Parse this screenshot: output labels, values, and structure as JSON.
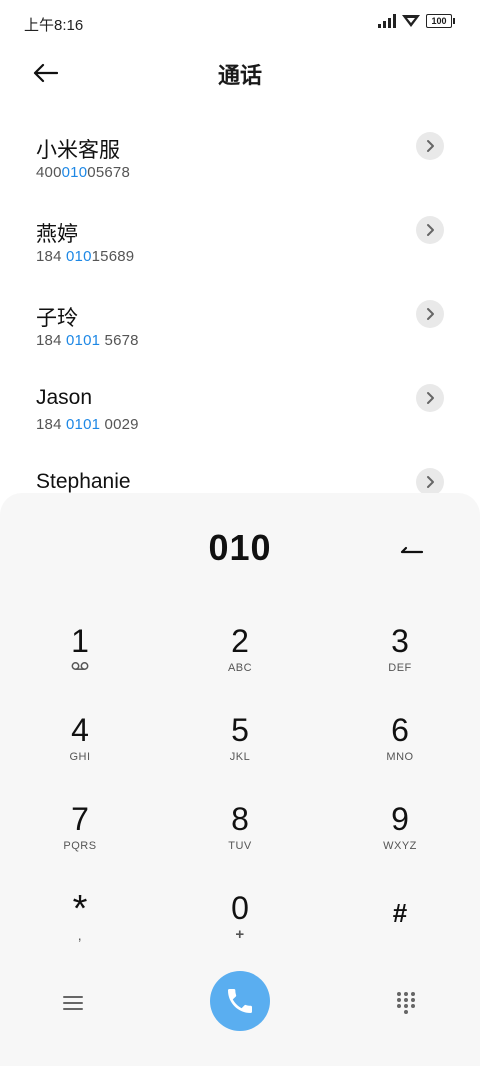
{
  "status_bar": {
    "time": "上午8:16",
    "battery": "100"
  },
  "header": {
    "title": "通话"
  },
  "contacts": [
    {
      "name": "小米客服",
      "number_parts": [
        "400",
        "010",
        "05678"
      ]
    },
    {
      "name": "燕婷",
      "number_parts": [
        "184 ",
        "010",
        "15689"
      ]
    },
    {
      "name": "子玲",
      "number_parts": [
        "184 ",
        "0101",
        " 5678"
      ]
    },
    {
      "name": "Jason",
      "number_parts": [
        "184 ",
        "0101",
        " 0029"
      ]
    },
    {
      "name": "Stephanie",
      "number_parts": [
        "",
        "",
        ""
      ]
    }
  ],
  "dialpad": {
    "dialed_number": "010",
    "keys": [
      {
        "digit": "1",
        "sub": ""
      },
      {
        "digit": "2",
        "sub": "ABC"
      },
      {
        "digit": "3",
        "sub": "DEF"
      },
      {
        "digit": "4",
        "sub": "GHI"
      },
      {
        "digit": "5",
        "sub": "JKL"
      },
      {
        "digit": "6",
        "sub": "MNO"
      },
      {
        "digit": "7",
        "sub": "PQRS"
      },
      {
        "digit": "8",
        "sub": "TUV"
      },
      {
        "digit": "9",
        "sub": "WXYZ"
      },
      {
        "digit": "*",
        "sub": ","
      },
      {
        "digit": "0",
        "sub": "+"
      },
      {
        "digit": "#",
        "sub": ""
      }
    ]
  },
  "icons": {
    "back": "back-arrow-icon",
    "detail": "chevron-right-icon",
    "backspace": "backspace-icon",
    "voicemail": "voicemail-icon",
    "menu": "menu-icon",
    "call": "phone-icon",
    "dialpad_toggle": "dialpad-grid-icon"
  },
  "colors": {
    "highlight": "#1e88e5",
    "call_button": "#5aaef0"
  }
}
